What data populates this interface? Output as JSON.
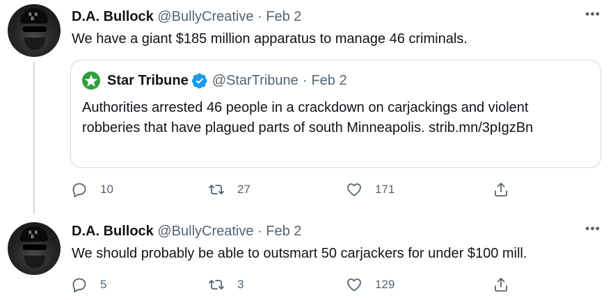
{
  "tweets": [
    {
      "display_name": "D.A. Bullock",
      "handle": "@BullyCreative",
      "separator": "·",
      "date": "Feb 2",
      "text": "We have a giant $185 million apparatus to manage 46 criminals.",
      "more_glyph": "•••",
      "avatar_text": "8 8\n B",
      "quote": {
        "name": "Star Tribune",
        "handle": "@StarTribune",
        "separator": "·",
        "date": "Feb 2",
        "text": "Authorities arrested 46 people in a crackdown on carjackings and violent robberies that have plagued parts of south Minneapolis.   strib.mn/3pIgzBn",
        "logo_color": "#2e9e3c",
        "verified_color": "#1d9bf0"
      },
      "actions": {
        "replies": "10",
        "retweets": "27",
        "likes": "171"
      }
    },
    {
      "display_name": "D.A. Bullock",
      "handle": "@BullyCreative",
      "separator": "·",
      "date": "Feb 2",
      "text": "We should probably be able to outsmart 50 carjackers for under $100 mill.",
      "more_glyph": "•••",
      "avatar_text": "8 8\n B",
      "actions": {
        "replies": "5",
        "retweets": "3",
        "likes": "129"
      }
    }
  ],
  "icons": {
    "reply": "reply-icon",
    "retweet": "retweet-icon",
    "like": "heart-icon",
    "share": "share-icon",
    "more": "more-icon",
    "verified": "verified-icon",
    "logo": "star-tribune-logo-icon"
  },
  "colors": {
    "text": "#0f1419",
    "secondary": "#536471",
    "border": "#cfd9de"
  }
}
